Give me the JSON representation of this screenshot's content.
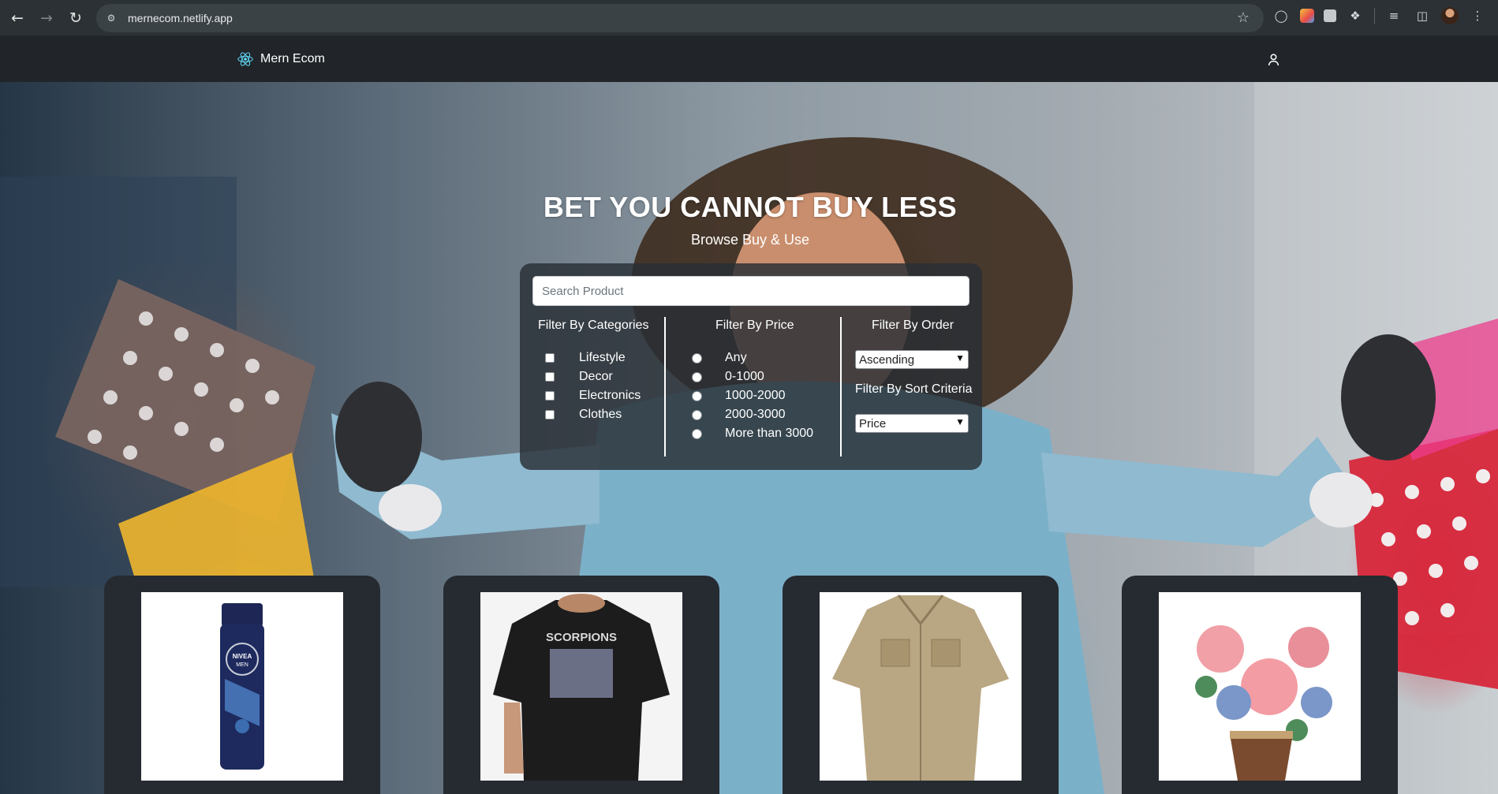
{
  "browser": {
    "url": "mernecom.netlify.app",
    "back_icon": "back-arrow-icon",
    "forward_icon": "forward-arrow-icon",
    "reload_icon": "reload-icon"
  },
  "navbar": {
    "brand": "Mern Ecom",
    "brand_icon": "react-logo-icon",
    "user_icon": "user-icon"
  },
  "hero": {
    "title": "BET YOU CANNOT BUY LESS",
    "subtitle": "Browse Buy & Use"
  },
  "search": {
    "placeholder": "Search Product",
    "value": ""
  },
  "filters": {
    "categories": {
      "heading": "Filter By Categories",
      "options": [
        "Lifestyle",
        "Decor",
        "Electronics",
        "Clothes"
      ]
    },
    "price": {
      "heading": "Filter By Price",
      "options": [
        "Any",
        "0-1000",
        "1000-2000",
        "2000-3000",
        "More than 3000"
      ]
    },
    "order": {
      "heading": "Filter By Order",
      "selected": "Ascending"
    },
    "sort": {
      "heading": "Filter By Sort Criteria",
      "selected": "Price"
    }
  },
  "products": [
    {
      "image": "deodorant-spray-can"
    },
    {
      "image": "scorpions-band-tshirt"
    },
    {
      "image": "khaki-shirt"
    },
    {
      "image": "flower-vase-decor"
    }
  ],
  "product_labels": {
    "deodorant_brand": "NIVEA",
    "deodorant_line": "MEN",
    "tshirt_band": "SCORPIONS"
  },
  "colors": {
    "navbar": "#212529",
    "panel": "#282e34",
    "card": "#262b31",
    "chrome": "#2b3135"
  }
}
